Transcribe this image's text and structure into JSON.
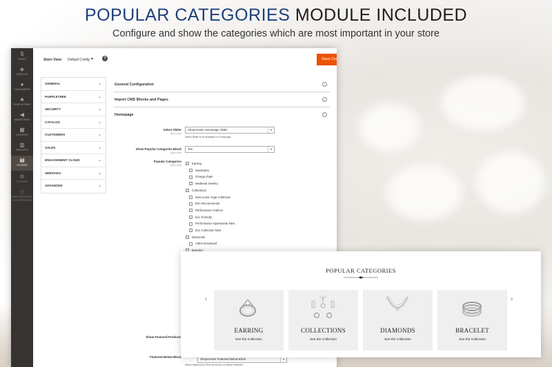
{
  "headline": {
    "accent": "POPULAR CATEGORIES",
    "rest": " MODULE INCLUDED"
  },
  "subline": "Configure and show the categories which are most important in your store",
  "sidebar": {
    "items": [
      {
        "icon": "$",
        "label": "SALES"
      },
      {
        "icon": "◈",
        "label": "CATALOG"
      },
      {
        "icon": "●",
        "label": "CUSTOMERS"
      },
      {
        "icon": "♣",
        "label": "PURPLETREE"
      },
      {
        "icon": "◀",
        "label": "MARKETING"
      },
      {
        "icon": "▦",
        "label": "CONTENT"
      },
      {
        "icon": "▥",
        "label": "REPORTS"
      },
      {
        "icon": "▤",
        "label": "STORES"
      },
      {
        "icon": "⚙",
        "label": "SYSTEM"
      },
      {
        "icon": "◇",
        "label": "FIND PARTNERS & EXTENSIONS"
      }
    ]
  },
  "topbar": {
    "store_view_label": "Store View:",
    "store_view_value": "Default Config",
    "save_label": "Save Config"
  },
  "config_nav": [
    "GENERAL",
    "PURPLETREE",
    "SECURITY",
    "CATALOG",
    "CUSTOMERS",
    "SALES",
    "ENGAGEMENT CLOUD",
    "SERVICES",
    "ADVANCED"
  ],
  "sections": {
    "general": "General Configuration",
    "import": "Import CMS Blocks and Pages",
    "homepage": "Homepage"
  },
  "form": {
    "select_slider": {
      "label": "Select Slider",
      "scope": "[store view]",
      "value": "ShopAmaze Homepage Slider",
      "hint": "Select Slider to be displayed on homepage"
    },
    "show_popular": {
      "label": "Show Popular Categories Block",
      "scope": "[store view]",
      "value": "Yes"
    },
    "popular_categories": {
      "label": "Popular Categories",
      "scope": "[store view]"
    },
    "show_featured": {
      "label": "Show Featured Products"
    },
    "featured_below": {
      "label": "Featured Below Block",
      "value": "ShopAmaze Featured Below Block",
      "hint": "Select Static block Store be shown on below Featured"
    }
  },
  "categories": [
    {
      "name": "Earring",
      "checked": true,
      "level": 0
    },
    {
      "name": "Navaratna",
      "checked": false,
      "level": 1
    },
    {
      "name": "Omega chain",
      "checked": false,
      "level": 1
    },
    {
      "name": "Medieval Jewelry",
      "checked": false,
      "level": 1
    },
    {
      "name": "Collections",
      "checked": true,
      "level": 0
    },
    {
      "name": "New Luma Yoga Collection",
      "checked": false,
      "level": 1
    },
    {
      "name": "Erin Recommends",
      "checked": false,
      "level": 1
    },
    {
      "name": "Performance Fabrics",
      "checked": false,
      "level": 1
    },
    {
      "name": "Eco Friendly",
      "checked": false,
      "level": 1
    },
    {
      "name": "Performance Sportswear New",
      "checked": false,
      "level": 1
    },
    {
      "name": "Eco Collection New",
      "checked": false,
      "level": 1
    },
    {
      "name": "Diamonds",
      "checked": true,
      "level": 0
    },
    {
      "name": "Video Download",
      "checked": false,
      "level": 1
    },
    {
      "name": "Bracelet",
      "checked": true,
      "level": 0
    }
  ],
  "popular": {
    "title": "POPULAR CATEGORIES",
    "link_label": "See the Collection",
    "cards": [
      {
        "name": "EARRING",
        "icon": "ring-icon"
      },
      {
        "name": "COLLECTIONS",
        "icon": "jewelry-set-icon"
      },
      {
        "name": "DIAMONDS",
        "icon": "necklace-icon"
      },
      {
        "name": "BRACELET",
        "icon": "bracelet-icon"
      }
    ]
  }
}
